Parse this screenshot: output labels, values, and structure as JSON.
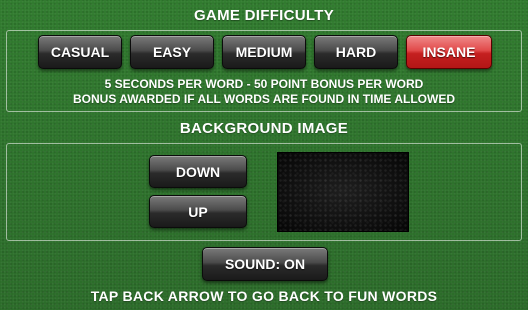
{
  "difficulty": {
    "heading": "GAME DIFFICULTY",
    "options": [
      "CASUAL",
      "EASY",
      "MEDIUM",
      "HARD",
      "INSANE"
    ],
    "selected": "INSANE",
    "info_line1": "5 SECONDS PER WORD - 50 POINT BONUS PER WORD",
    "info_line2": "BONUS AWARDED IF ALL WORDS ARE FOUND IN TIME ALLOWED"
  },
  "background": {
    "heading": "BACKGROUND IMAGE",
    "down_label": "DOWN",
    "up_label": "UP"
  },
  "sound": {
    "label": "SOUND: ON"
  },
  "footer": {
    "hint": "TAP BACK ARROW TO GO BACK TO FUN WORDS"
  },
  "colors": {
    "felt": "#2d6e2b",
    "selected_button": "#d93030",
    "button": "#3a3a3a",
    "text": "#ffffff"
  }
}
